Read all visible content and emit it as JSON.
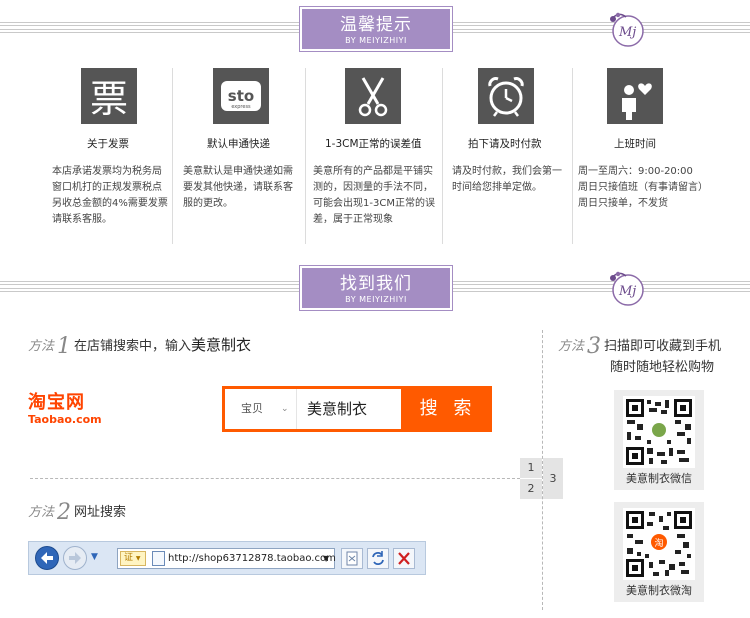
{
  "notice_band": {
    "title": "温馨提示",
    "subtitle": "BY MEIYIZHIYI",
    "logo_text": "Myz"
  },
  "info": [
    {
      "icon": "ticket-glyph-icon",
      "glyph": "票",
      "title": "关于发票",
      "text": "本店承诺发票均为税务局窗口机打的正规发票税点另收总金额的4%需要发票请联系客服。"
    },
    {
      "icon": "sto-express-icon",
      "glyph": "sto",
      "glyph_sub": "express",
      "title": "默认申通快递",
      "text": "美意默认是申通快递如需要发其他快递，请联系客服的更改。"
    },
    {
      "icon": "scissors-icon",
      "title": "1-3CM正常的误差值",
      "text": "美意所有的产品都是平铺实测的，因测量的手法不同，可能会出现1-3CM正常的误差，属于正常现象"
    },
    {
      "icon": "alarm-clock-icon",
      "title": "拍下请及时付款",
      "text": "请及时付款，我们会第一时间给您排单定做。"
    },
    {
      "icon": "person-heart-icon",
      "title": "上班时间",
      "lines": [
        "周一至周六：9:00-20:00",
        "周日只接值班（有事请留言）",
        "周日只接单，不发货"
      ]
    }
  ],
  "find_band": {
    "title": "找到我们",
    "subtitle": "BY MEIYIZHIYI",
    "logo_text": "Myz"
  },
  "method1": {
    "word": "方法",
    "num": "1",
    "text": "在店铺搜索中，输入",
    "brand": "美意制衣"
  },
  "taobao": {
    "cn": "淘宝网",
    "en": "Taobao.com"
  },
  "search": {
    "category": "宝贝",
    "query": "美意制衣",
    "button": "搜 索"
  },
  "steps": [
    "1",
    "2",
    "3"
  ],
  "method2": {
    "word": "方法",
    "num": "2",
    "text": "网址搜索"
  },
  "browser": {
    "cert": "证",
    "url": "http://shop63712878.taobao.com"
  },
  "method3": {
    "word": "方法",
    "num": "3",
    "line1": "扫描即可收藏到手机",
    "line2": "随时随地轻松购物"
  },
  "qr": [
    {
      "caption": "美意制衣微信"
    },
    {
      "caption": "美意制衣微淘",
      "badge": "淘"
    }
  ]
}
